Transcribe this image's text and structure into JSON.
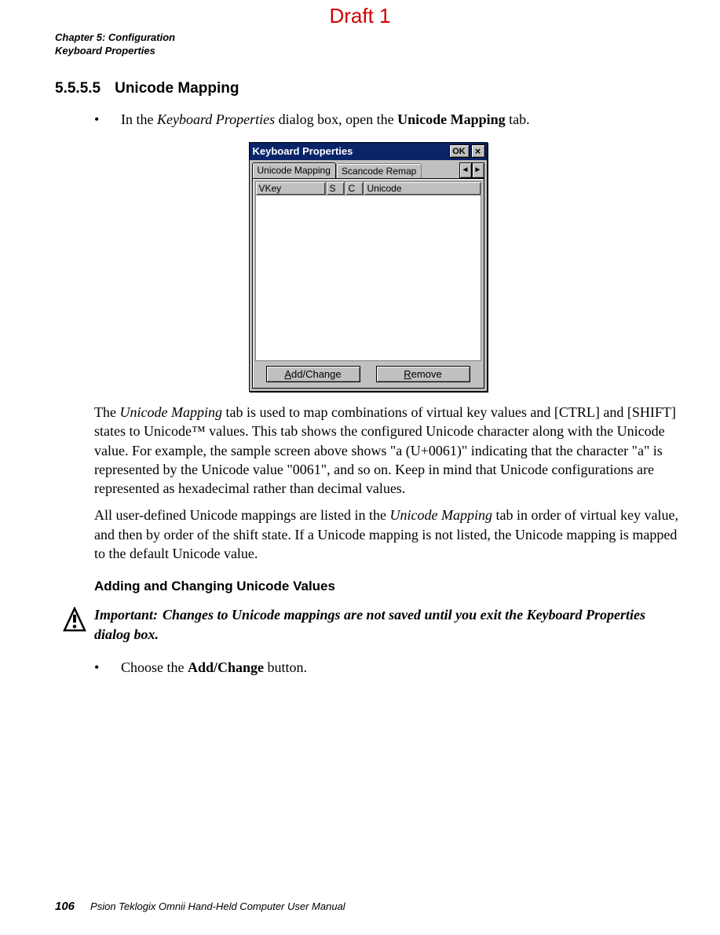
{
  "draft_label": "Draft 1",
  "running_head": {
    "line1": "Chapter 5: Configuration",
    "line2": "Keyboard Properties"
  },
  "section": {
    "number": "5.5.5.5",
    "title": "Unicode Mapping"
  },
  "bullet1": {
    "marker": "•",
    "pre": "In the ",
    "italic": "Keyboard Properties",
    "mid": " dialog box, open the ",
    "bold": "Unicode Mapping",
    "post": " tab."
  },
  "dialog": {
    "title": "Keyboard Properties",
    "ok": "OK",
    "close": "×",
    "tabs": {
      "active": "Unicode Mapping",
      "next": "Scancode Remap"
    },
    "scroll": {
      "left": "◄",
      "right": "►"
    },
    "cols": {
      "vkey": "VKey",
      "s": "S",
      "c": "C",
      "unicode": "Unicode"
    },
    "buttons": {
      "add_a": "A",
      "add_rest": "dd/Change",
      "rem_r": "R",
      "rem_rest": "emove"
    }
  },
  "para1": {
    "p1a": "The ",
    "p1i": "Unicode Mapping",
    "p1b": " tab is used to map combinations of virtual key values and [CTRL] and [SHIFT] states to Unicode™ values. This tab shows the configured Unicode character along with the Unicode value. For example, the sample screen above shows \"a (U+0061)\" indicating that the character \"a\" is represented by the Unicode value \"0061\", and so on. Keep in mind that Unicode configurations are represented as hexadecimal rather than decimal values."
  },
  "para2": {
    "p2a": "All user-defined Unicode mappings are listed in the ",
    "p2i": "Unicode Mapping",
    "p2b": " tab in order of virtual key value, and then by order of the shift state. If a Unicode mapping is not listed, the Unicode mapping is mapped to the default Unicode value."
  },
  "subheading": "Adding and Changing Unicode Values",
  "important": {
    "label": "Important:",
    "text": "Changes to Unicode mappings are not saved until you exit the Keyboard Properties dialog box."
  },
  "bullet2": {
    "marker": "•",
    "pre": "Choose the ",
    "bold": "Add/Change",
    "post": " button."
  },
  "footer": {
    "page": "106",
    "text": "Psion Teklogix Omnii Hand-Held Computer User Manual"
  }
}
